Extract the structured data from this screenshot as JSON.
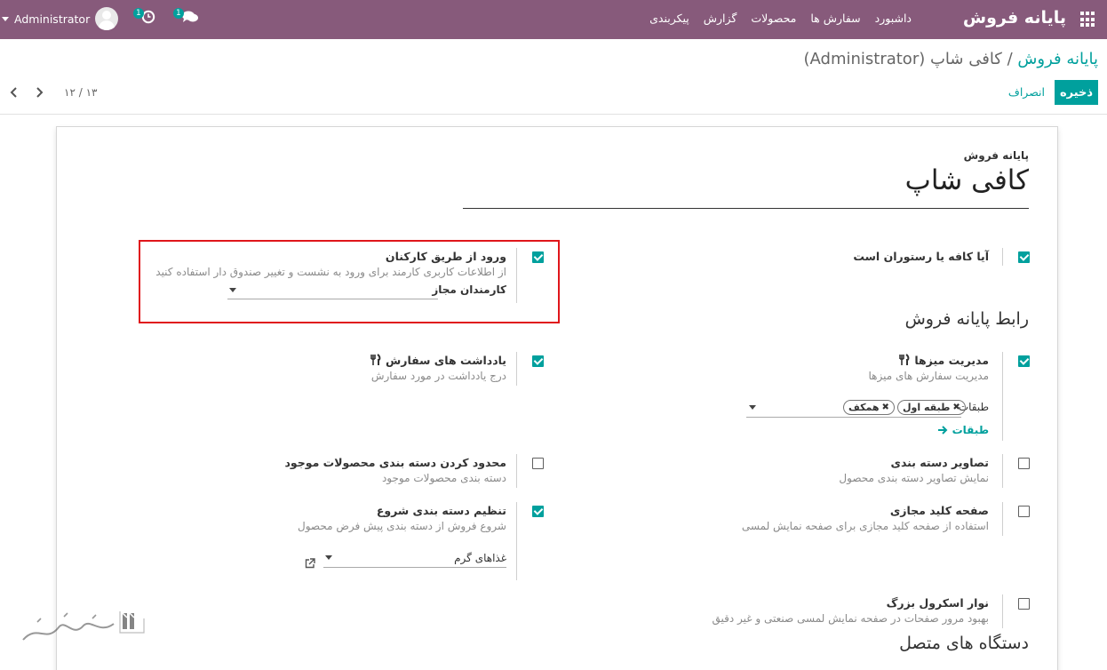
{
  "navbar": {
    "brand": "پایانه فروش",
    "menu": [
      "داشبورد",
      "سفارش ها",
      "محصولات",
      "گزارش",
      "پیکربندی"
    ],
    "user_name": "Administrator",
    "activity_badge": "1",
    "messages_badge": "1"
  },
  "breadcrumb": {
    "parent": "پایانه فروش",
    "separator": "/",
    "current": "کافی شاپ (Administrator)"
  },
  "actions": {
    "save_label": "ذخیره",
    "discard_label": "انصراف"
  },
  "pager": {
    "value": "۱۲ / ۱۳"
  },
  "form": {
    "field_label": "پایانه فروش",
    "name": "کافی شاپ",
    "settings": {
      "is_restaurant": {
        "label": "آیا کافه یا رستوران است",
        "checked": true
      },
      "employee_login": {
        "label": "ورود از طریق کارکنان",
        "desc": "از اطلاعات کاربری کارمند برای ورود به نشست و تغییر صندوق دار استفاده کنید",
        "field_value": "کارمندان مجاز",
        "checked": true
      },
      "section_interface": "رابط پایانه فروش",
      "table_management": {
        "label": "مدیریت میزها",
        "desc": "مدیریت سفارش های میزها",
        "floors_label": "طبقات",
        "tags": [
          "طبقه اول",
          "همکف"
        ],
        "floors_link": "طبقات",
        "checked": true
      },
      "order_notes": {
        "label": "یادداشت های سفارش",
        "desc": "درج یادداشت در مورد سفارش",
        "checked": true
      },
      "category_images": {
        "label": "تصاویر دسته بندی",
        "desc": "نمایش تصاویر دسته بندی محصول",
        "checked": false
      },
      "limit_categories": {
        "label": "محدود کردن دسته بندی محصولات موجود",
        "desc": "دسته بندی محصولات موجود",
        "checked": false
      },
      "virtual_keyboard": {
        "label": "صفحه کلید مجازی",
        "desc": "استفاده از صفحه کلید مجازی برای صفحه نمایش لمسی",
        "checked": false
      },
      "start_category": {
        "label": "تنظیم دسته بندی شروع",
        "desc": "شروع فروش از دسته بندی پیش فرض محصول",
        "field_value": "غذاهای گرم",
        "checked": true
      },
      "large_scrollbars": {
        "label": "نوار اسکرول بزرگ",
        "desc": "بهبود مرور صفحات در صفحه نمایش لمسی صنعتی و غیر دقیق",
        "checked": false
      },
      "section_devices": "دستگاه های متصل"
    }
  },
  "colors": {
    "navbar": "#875a7b",
    "accent": "#00a09d",
    "highlight": "#e0161b"
  }
}
